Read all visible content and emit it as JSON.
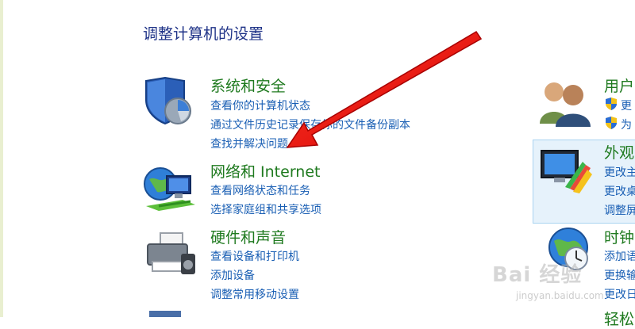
{
  "page": {
    "title": "调整计算机的设置"
  },
  "categories": {
    "system": {
      "title": "系统和安全",
      "links": [
        "查看你的计算机状态",
        "通过文件历史记录保存你的文件备份副本",
        "查找并解决问题"
      ]
    },
    "network": {
      "title": "网络和 Internet",
      "links": [
        "查看网络状态和任务",
        "选择家庭组和共享选项"
      ]
    },
    "hardware": {
      "title": "硬件和声音",
      "links": [
        "查看设备和打印机",
        "添加设备",
        "调整常用移动设置"
      ]
    },
    "users": {
      "title": "用户",
      "links": [
        "更",
        "为"
      ]
    },
    "appearance": {
      "title": "外观",
      "links": [
        "更改主",
        "更改桌",
        "调整屏"
      ]
    },
    "clock": {
      "title": "时钟",
      "links": [
        "添加语",
        "更换输",
        "更改日"
      ]
    },
    "bottom_cut": {
      "title": "轻松"
    }
  },
  "watermark": {
    "text": "Bai 经验",
    "sub": "jingyan.baidu.com"
  },
  "colors": {
    "title": "#1e3287",
    "category": "#1f7a1f",
    "link": "#1a5fb4",
    "arrow": "#e31010"
  }
}
